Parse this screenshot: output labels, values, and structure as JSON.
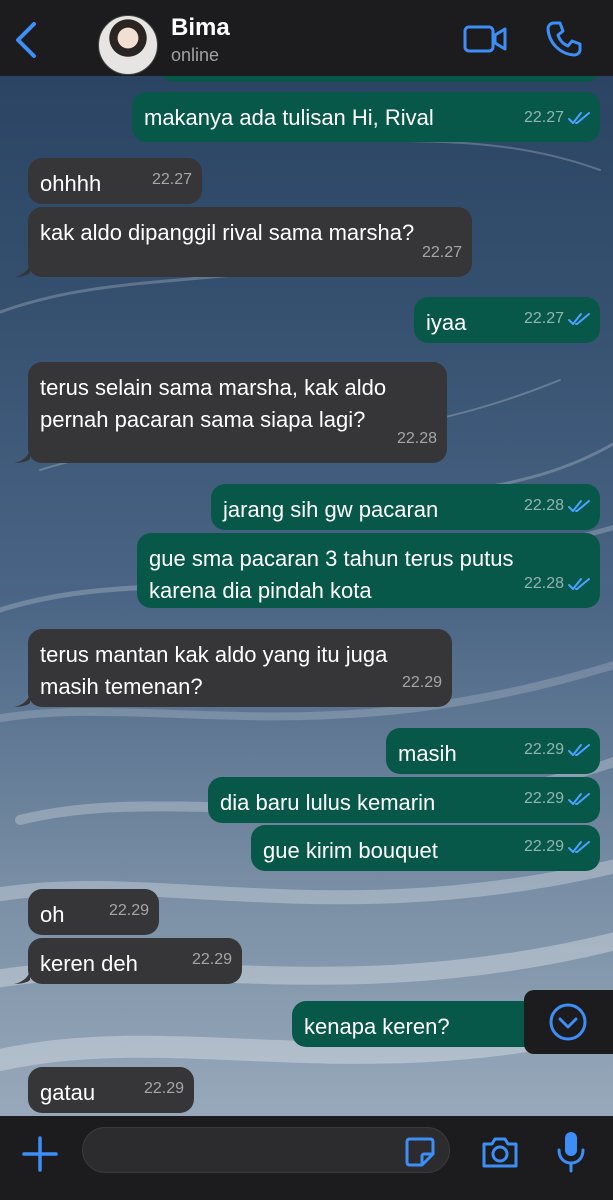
{
  "contact": {
    "name": "Bima",
    "status": "online"
  },
  "colors": {
    "accent": "#3d8ff7",
    "incoming": "#363638",
    "outgoing": "#08584a",
    "bar": "#1c1c1e"
  },
  "icons": {
    "back": "chevron-left-icon",
    "video": "video-call-icon",
    "phone": "phone-icon",
    "scroll": "chevron-down-icon",
    "plus": "plus-icon",
    "sticker": "sticker-icon",
    "camera": "camera-icon",
    "mic": "microphone-icon"
  },
  "messages": [
    {
      "dir": "out",
      "text": "",
      "time": "22.27",
      "read": true
    },
    {
      "dir": "out",
      "text": "makanya ada tulisan Hi, Rival",
      "time": "22.27",
      "read": true
    },
    {
      "dir": "in",
      "text": "ohhhh",
      "time": "22.27"
    },
    {
      "dir": "in",
      "text": "kak aldo dipanggil rival sama marsha?",
      "time": "22.27"
    },
    {
      "dir": "out",
      "text": "iyaa",
      "time": "22.27",
      "read": true
    },
    {
      "dir": "in",
      "text": "terus selain sama marsha, kak aldo\npernah pacaran sama siapa lagi?",
      "time": "22.28"
    },
    {
      "dir": "out",
      "text": "jarang sih gw pacaran",
      "time": "22.28",
      "read": true
    },
    {
      "dir": "out",
      "text": "gue sma pacaran 3 tahun terus putus\nkarena dia pindah kota",
      "time": "22.28",
      "read": true
    },
    {
      "dir": "in",
      "text": "terus mantan kak aldo yang itu juga\nmasih temenan?",
      "time": "22.29"
    },
    {
      "dir": "out",
      "text": "masih",
      "time": "22.29",
      "read": true
    },
    {
      "dir": "out",
      "text": "dia baru lulus kemarin",
      "time": "22.29",
      "read": true
    },
    {
      "dir": "out",
      "text": "gue kirim bouquet",
      "time": "22.29",
      "read": true
    },
    {
      "dir": "in",
      "text": "oh",
      "time": "22.29"
    },
    {
      "dir": "in",
      "text": "keren deh",
      "time": "22.29"
    },
    {
      "dir": "out",
      "text": "kenapa keren?",
      "time": "22.",
      "read": true
    },
    {
      "dir": "in",
      "text": "gatau",
      "time": "22.29"
    }
  ],
  "composer": {
    "value": "",
    "placeholder": ""
  }
}
